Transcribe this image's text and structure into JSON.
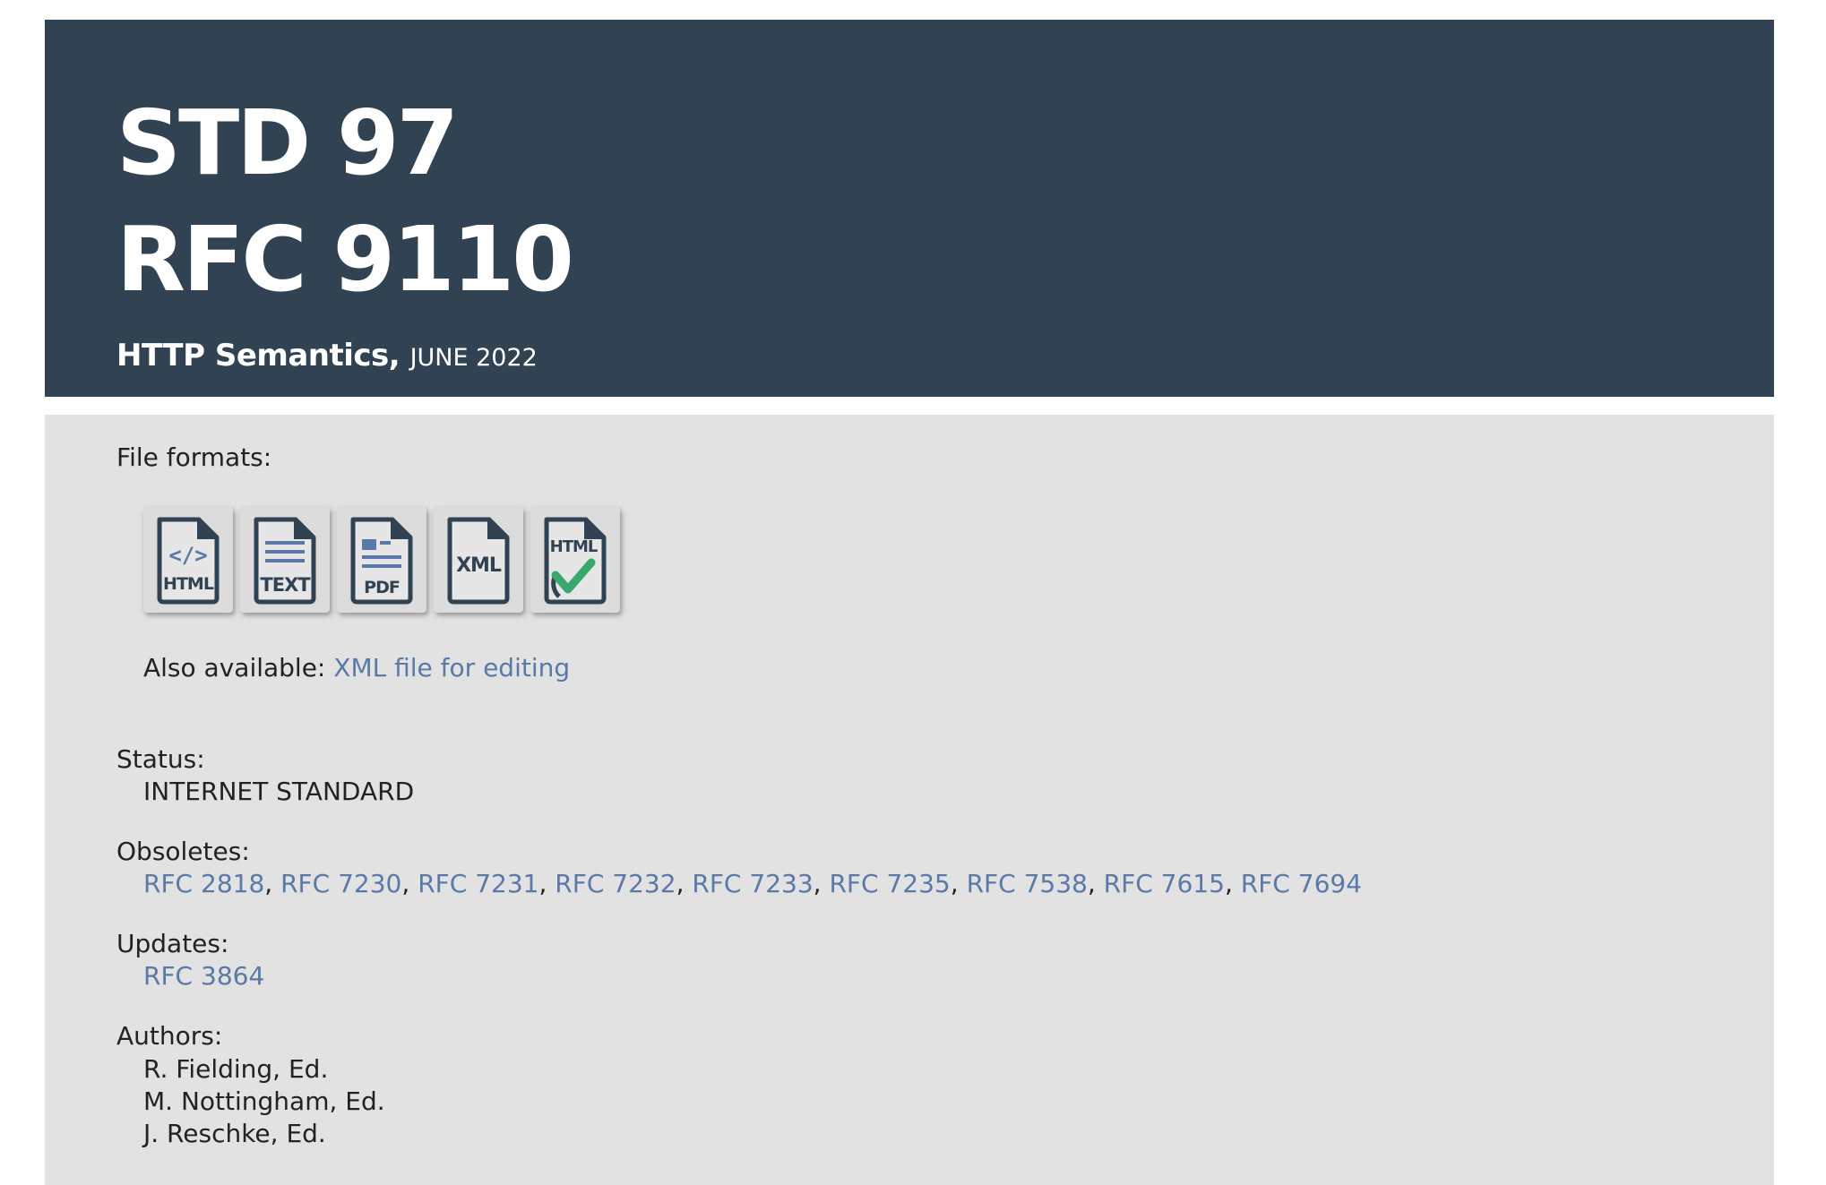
{
  "header": {
    "std": "STD 97",
    "rfc": "RFC 9110",
    "title": "HTTP Semantics,",
    "date": "JUNE 2022"
  },
  "file_formats": {
    "label": "File formats:",
    "items": [
      {
        "name": "html-format-icon",
        "text": "HTML"
      },
      {
        "name": "text-format-icon",
        "text": "TEXT"
      },
      {
        "name": "pdf-format-icon",
        "text": "PDF"
      },
      {
        "name": "xml-format-icon",
        "text": "XML"
      },
      {
        "name": "htmlized-format-icon",
        "text": "HTML"
      }
    ],
    "also_available_label": "Also available:",
    "also_available_link": "XML file for editing"
  },
  "status": {
    "label": "Status:",
    "value": "INTERNET STANDARD"
  },
  "obsoletes": {
    "label": "Obsoletes:",
    "items": [
      "RFC 2818",
      "RFC 7230",
      "RFC 7231",
      "RFC 7232",
      "RFC 7233",
      "RFC 7235",
      "RFC 7538",
      "RFC 7615",
      "RFC 7694"
    ],
    "separator": ","
  },
  "updates": {
    "label": "Updates:",
    "items": [
      "RFC 3864"
    ]
  },
  "authors": {
    "label": "Authors:",
    "items": [
      "R. Fielding, Ed.",
      "M. Nottingham, Ed.",
      "J. Reschke, Ed."
    ]
  },
  "colors": {
    "header_bg": "#314352",
    "panel_bg": "#e2e2e2",
    "link": "#5a79a6",
    "icon_dark": "#314352",
    "icon_accent": "#5a79a6",
    "check_green": "#3aa76d"
  }
}
